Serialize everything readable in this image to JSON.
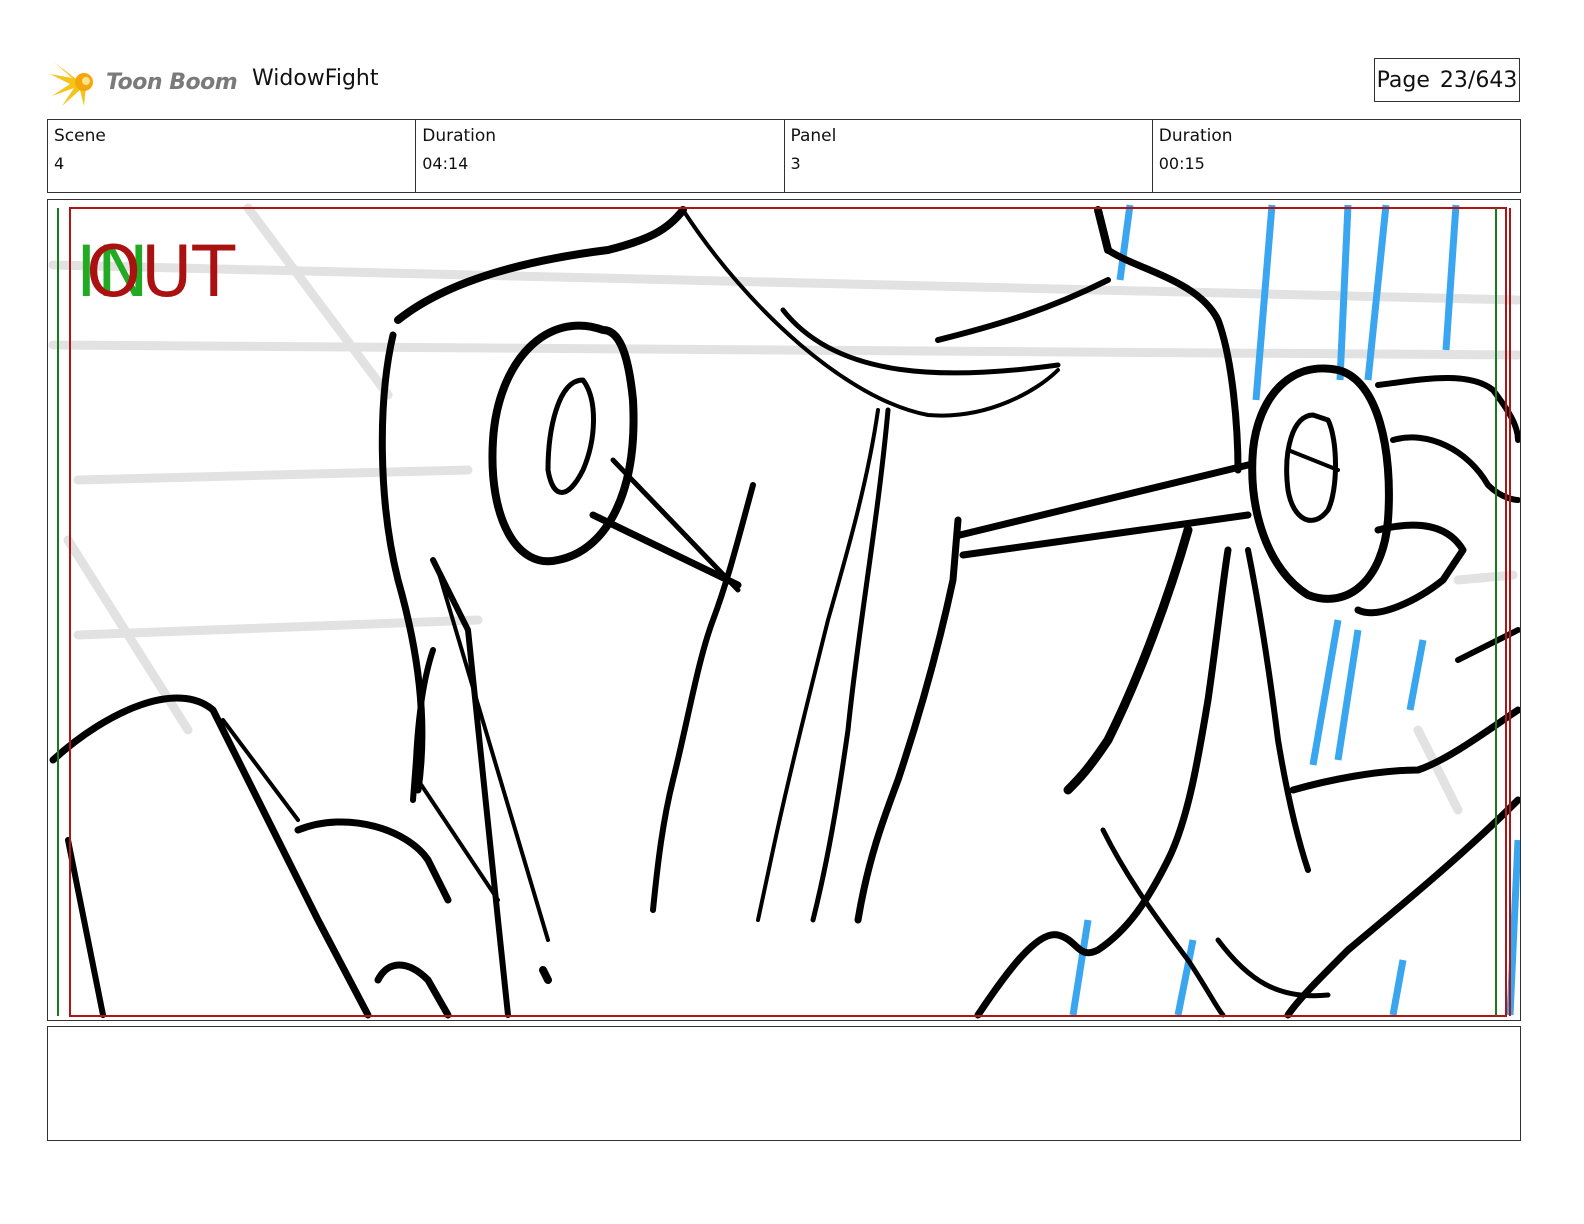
{
  "header": {
    "logo_text": "Toon Boom",
    "project_title": "WidowFight",
    "page_label": "Page",
    "page_value": "23/643"
  },
  "info": {
    "scene_label": "Scene",
    "scene_value": "4",
    "scene_duration_label": "Duration",
    "scene_duration_value": "04:14",
    "panel_label": "Panel",
    "panel_value": "3",
    "panel_duration_label": "Duration",
    "panel_duration_value": "00:15"
  },
  "panel": {
    "in_marker": "IN",
    "out_marker": "OUT",
    "safe_area_color": "#1a7a1a",
    "frame_color": "#b01515",
    "in_color": "#22aa22",
    "out_color": "#aa1111",
    "fx_line_color": "#3aa6f0"
  },
  "notes": {
    "text": ""
  }
}
